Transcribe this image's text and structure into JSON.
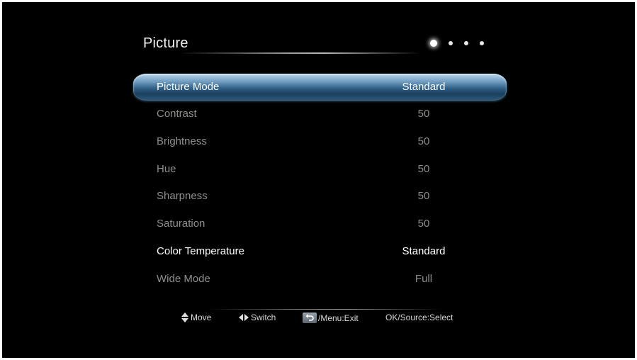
{
  "header": {
    "title": "Picture",
    "page_count": 4,
    "active_page": 1
  },
  "menu": {
    "items": [
      {
        "label": "Picture Mode",
        "value": "Standard",
        "state": "selected"
      },
      {
        "label": "Contrast",
        "value": "50",
        "state": "dim"
      },
      {
        "label": "Brightness",
        "value": "50",
        "state": "dim"
      },
      {
        "label": "Hue",
        "value": "50",
        "state": "dim"
      },
      {
        "label": "Sharpness",
        "value": "50",
        "state": "dim"
      },
      {
        "label": "Saturation",
        "value": "50",
        "state": "dim"
      },
      {
        "label": "Color Temperature",
        "value": "Standard",
        "state": "bright"
      },
      {
        "label": "Wide Mode",
        "value": "Full",
        "state": "dim"
      }
    ]
  },
  "footer": {
    "hints": [
      {
        "icon": "up-down-arrows-icon",
        "label": "Move"
      },
      {
        "icon": "left-right-arrows-icon",
        "label": "Switch"
      },
      {
        "icon": "back-return-icon",
        "label": "/Menu:Exit"
      },
      {
        "icon": "",
        "label": "OK/Source:Select"
      }
    ]
  },
  "colors": {
    "background": "#000000",
    "selected_bar": "#2f5f86",
    "text_active": "#ffffff",
    "text_dim": "#8e8e8e"
  }
}
